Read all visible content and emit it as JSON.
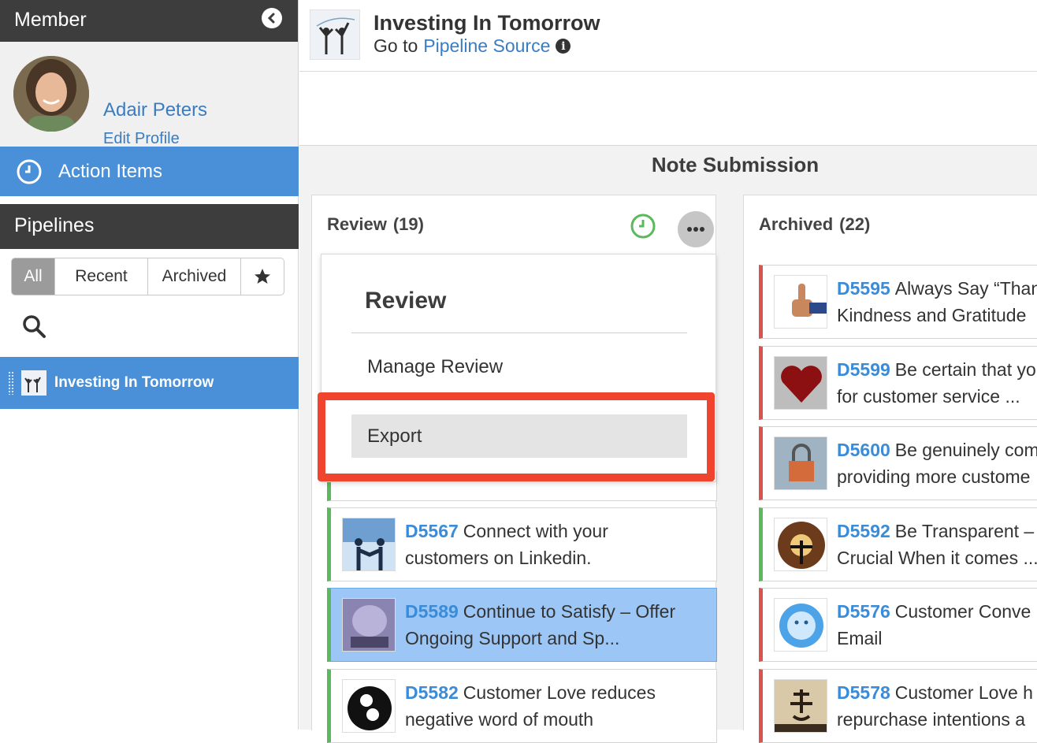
{
  "sidebar": {
    "header_title": "Member",
    "member_name": "Adair Peters",
    "edit_profile": "Edit Profile",
    "action_items": "Action Items",
    "pipelines_title": "Pipelines",
    "filters": [
      "All",
      "Recent",
      "Archived"
    ],
    "active_filter": "All",
    "pipeline_item": "Investing In Tomorrow"
  },
  "topbar": {
    "title": "Investing In Tomorrow",
    "goto_prefix": "Go to",
    "goto_link": "Pipeline Source"
  },
  "section_title": "Note Submission",
  "review": {
    "label": "Review",
    "count": "(19)",
    "cards": [
      {
        "id": "D5567",
        "line1": "Connect with your",
        "line2": "customers on Linkedin."
      },
      {
        "id": "D5589",
        "line1": "Continue to Satisfy – Offer",
        "line2": "Ongoing Support and Sp..."
      },
      {
        "id": "D5582",
        "line1": "Customer Love reduces",
        "line2": "negative word of mouth"
      }
    ]
  },
  "archived": {
    "label": "Archived",
    "count": "(22)",
    "cards": [
      {
        "id": "D5595",
        "line1": "Always Say “Than",
        "line2": "Kindness and Gratitude"
      },
      {
        "id": "D5599",
        "line1": "Be certain that yo",
        "line2": "for customer service ..."
      },
      {
        "id": "D5600",
        "line1": "Be genuinely com",
        "line2": "providing more custome"
      },
      {
        "id": "D5592",
        "line1": "Be Transparent –",
        "line2": "Crucial When it comes ..."
      },
      {
        "id": "D5576",
        "line1": "Customer Conve",
        "line2": "Email"
      },
      {
        "id": "D5578",
        "line1": "Customer Love h",
        "line2": "repurchase intentions a"
      }
    ]
  },
  "menu": {
    "title": "Review",
    "manage": "Manage Review",
    "export": "Export"
  },
  "colors": {
    "accent_blue": "#4a90d9",
    "link_blue": "#3a7cc1",
    "dark_header": "#3d3d3d",
    "status_green": "#5cb85c",
    "status_red": "#d9534f",
    "highlight": "#f0442e"
  }
}
